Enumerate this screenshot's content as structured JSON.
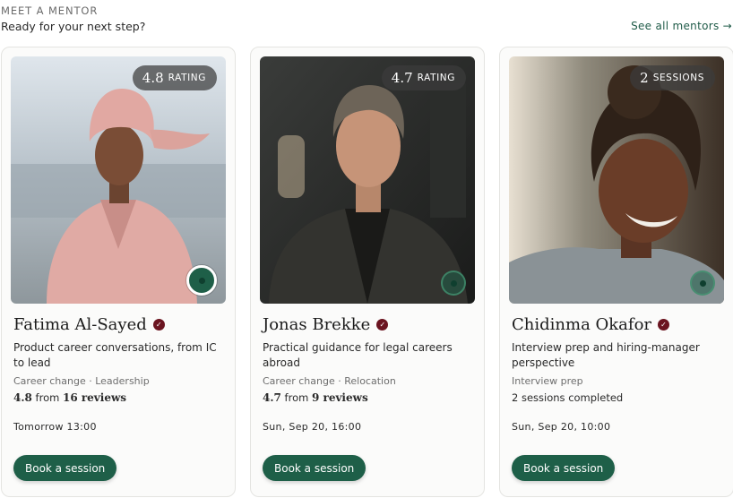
{
  "header": {
    "eyebrow": "MEET A MENTOR",
    "subtitle": "Ready for your next step?",
    "see_all": "See all mentors →"
  },
  "colors": {
    "accent": "#1e5f48",
    "verified_badge": "#6b1420",
    "card_background": "#fbfbfa"
  },
  "mentors": [
    {
      "stat_value": "4.8",
      "stat_unit": "RATING",
      "name": "Fatima Al-Sayed",
      "tagline": "Product career conversations, from IC to lead",
      "topics": "Career change · Leadership",
      "rating": "4.8",
      "stats_mid": "from",
      "reviews": "16 reviews",
      "completed": "",
      "next_slot": "Tomorrow 13:00",
      "book_label": "Book a session",
      "badge_icon": "verified-check-icon",
      "active": true
    },
    {
      "stat_value": "4.7",
      "stat_unit": "RATING",
      "name": "Jonas Brekke",
      "tagline": "Practical guidance for legal careers abroad",
      "topics": "Career change · Relocation",
      "rating": "4.7",
      "stats_mid": "from",
      "reviews": "9 reviews",
      "completed": "",
      "next_slot": "Sun, Sep 20, 16:00",
      "book_label": "Book a session",
      "badge_icon": "verified-check-icon",
      "active": false
    },
    {
      "stat_value": "2",
      "stat_unit": "SESSIONS",
      "name": "Chidinma Okafor",
      "tagline": "Interview prep and hiring-manager perspective",
      "topics": "Interview prep",
      "rating": "",
      "stats_mid": "",
      "reviews": "",
      "completed": "2 sessions completed",
      "next_slot": "Sun, Sep 20, 10:00",
      "book_label": "Book a session",
      "badge_icon": "verified-check-icon",
      "active": false
    }
  ]
}
